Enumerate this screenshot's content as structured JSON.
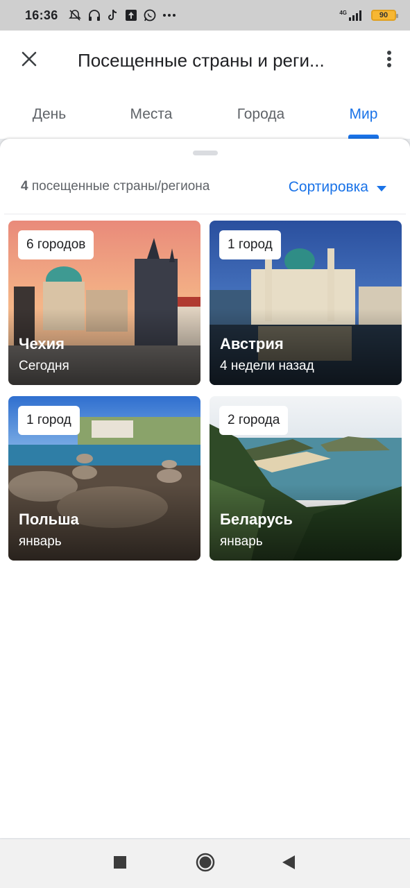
{
  "status_bar": {
    "time": "16:36",
    "network": "4G",
    "battery": "90",
    "icons": [
      "alarm-off-icon",
      "headphones-icon",
      "tiktok-icon",
      "upload-icon",
      "whatsapp-icon",
      "more-dots-icon",
      "signal-icon"
    ]
  },
  "app_bar": {
    "title": "Посещенные страны и реги..."
  },
  "tabs": [
    {
      "label": "День",
      "active": false
    },
    {
      "label": "Места",
      "active": false
    },
    {
      "label": "Города",
      "active": false
    },
    {
      "label": "Мир",
      "active": true
    }
  ],
  "summary": {
    "count": "4",
    "text": "посещенные страны/региона"
  },
  "sort": {
    "label": "Сортировка"
  },
  "cards": [
    {
      "badge": "6 городов",
      "name": "Чехия",
      "date": "Сегодня"
    },
    {
      "badge": "1 город",
      "name": "Австрия",
      "date": "4 недели назад"
    },
    {
      "badge": "1 город",
      "name": "Польша",
      "date": "январь"
    },
    {
      "badge": "2 города",
      "name": "Беларусь",
      "date": "январь"
    }
  ],
  "colors": {
    "accent": "#1a73e8",
    "text_secondary": "#5f6368"
  }
}
